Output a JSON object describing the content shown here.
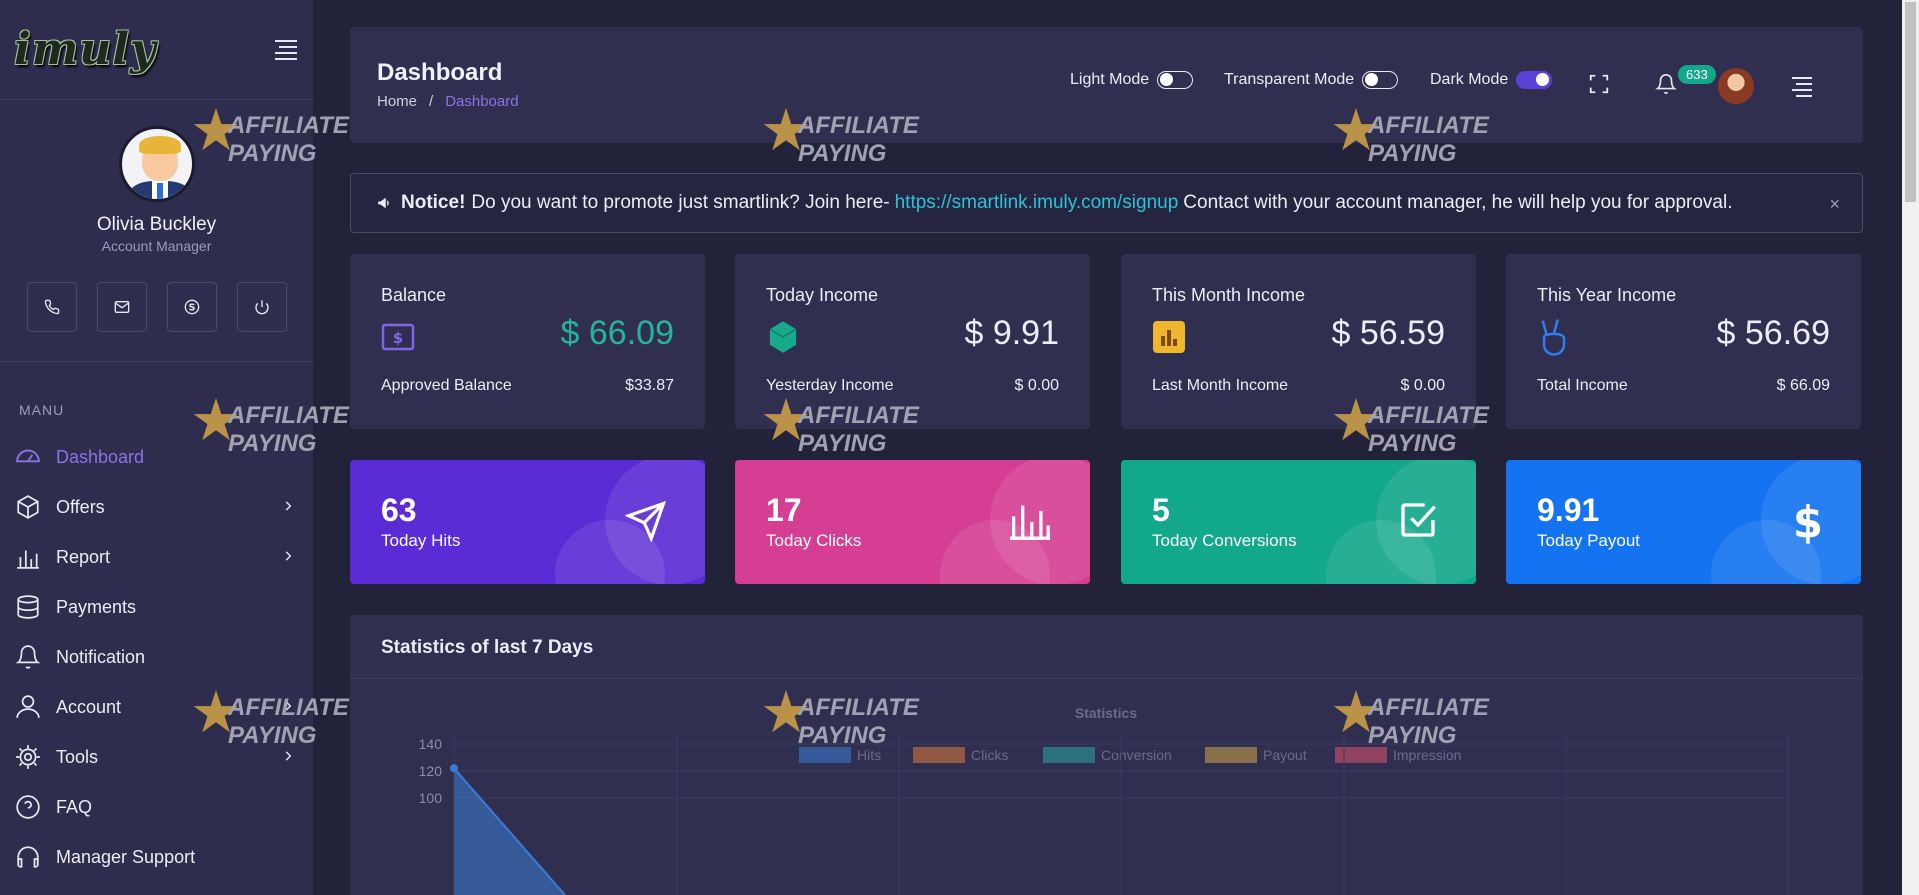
{
  "sidebar": {
    "logo": "imuly",
    "profile": {
      "name": "Olivia Buckley",
      "role": "Account Manager"
    },
    "menu_title": "MANU",
    "items": [
      {
        "label": "Dashboard",
        "icon": "dashboard-icon",
        "active": true
      },
      {
        "label": "Offers",
        "icon": "box-icon",
        "chevron": true
      },
      {
        "label": "Report",
        "icon": "bar-chart-icon",
        "chevron": true
      },
      {
        "label": "Payments",
        "icon": "database-icon"
      },
      {
        "label": "Notification",
        "icon": "bell-icon"
      },
      {
        "label": "Account",
        "icon": "user-icon",
        "chevron": true
      },
      {
        "label": "Tools",
        "icon": "gear-icon",
        "chevron": true
      },
      {
        "label": "FAQ",
        "icon": "question-icon"
      },
      {
        "label": "Manager Support",
        "icon": "headset-icon"
      }
    ]
  },
  "header": {
    "title": "Dashboard",
    "breadcrumb": {
      "home": "Home",
      "separator": "/",
      "current": "Dashboard"
    },
    "toggles": [
      {
        "label": "Light Mode",
        "on": false
      },
      {
        "label": "Transparent Mode",
        "on": false
      },
      {
        "label": "Dark Mode",
        "on": true
      }
    ],
    "notification_count": "633"
  },
  "notice": {
    "bold": "Notice!",
    "text_before": "Do you want to promote just smartlink? Join here-",
    "link": "https://smartlink.imuly.com/signup",
    "text_after": "Contact with your account manager, he will help you for approval.",
    "close": "×"
  },
  "stat_cards": [
    {
      "title": "Balance",
      "amount": "$ 66.09",
      "sub_label": "Approved Balance",
      "sub_value": "$33.87",
      "icon": "dollar-icon"
    },
    {
      "title": "Today Income",
      "amount": "$ 9.91",
      "sub_label": "Yesterday Income",
      "sub_value": "$ 0.00",
      "icon": "cube-icon"
    },
    {
      "title": "This Month Income",
      "amount": "$ 56.59",
      "sub_label": "Last Month Income",
      "sub_value": "$ 0.00",
      "icon": "chart-icon"
    },
    {
      "title": "This Year Income",
      "amount": "$ 56.69",
      "sub_label": "Total Income",
      "sub_value": "$ 66.09",
      "icon": "victory-hand-icon"
    }
  ],
  "color_cards": [
    {
      "value": "63",
      "label": "Today Hits",
      "icon": "paper-plane-icon",
      "color": "#5b2bd5"
    },
    {
      "value": "17",
      "label": "Today Clicks",
      "icon": "bar-chart-icon",
      "color": "#d63e93"
    },
    {
      "value": "5",
      "label": "Today Conversions",
      "icon": "check-square-icon",
      "color": "#12a88c"
    },
    {
      "value": "9.91",
      "label": "Today Payout",
      "icon": "dollar-icon",
      "color": "#1373f0"
    }
  ],
  "statistics": {
    "heading": "Statistics of last 7 Days"
  },
  "watermark": "AFFILIATE PAYING",
  "chart_data": {
    "type": "line",
    "title": "Statistics",
    "y_ticks": [
      140,
      120,
      100
    ],
    "legend_position": "top",
    "series": [
      {
        "name": "Hits",
        "color": "#3a7bd5",
        "values": [
          122
        ]
      },
      {
        "name": "Clicks",
        "color": "#e07b39"
      },
      {
        "name": "Conversion",
        "color": "#2aa7a0"
      },
      {
        "name": "Payout",
        "color": "#d3a548"
      },
      {
        "name": "Impression",
        "color": "#e0546f"
      }
    ]
  }
}
